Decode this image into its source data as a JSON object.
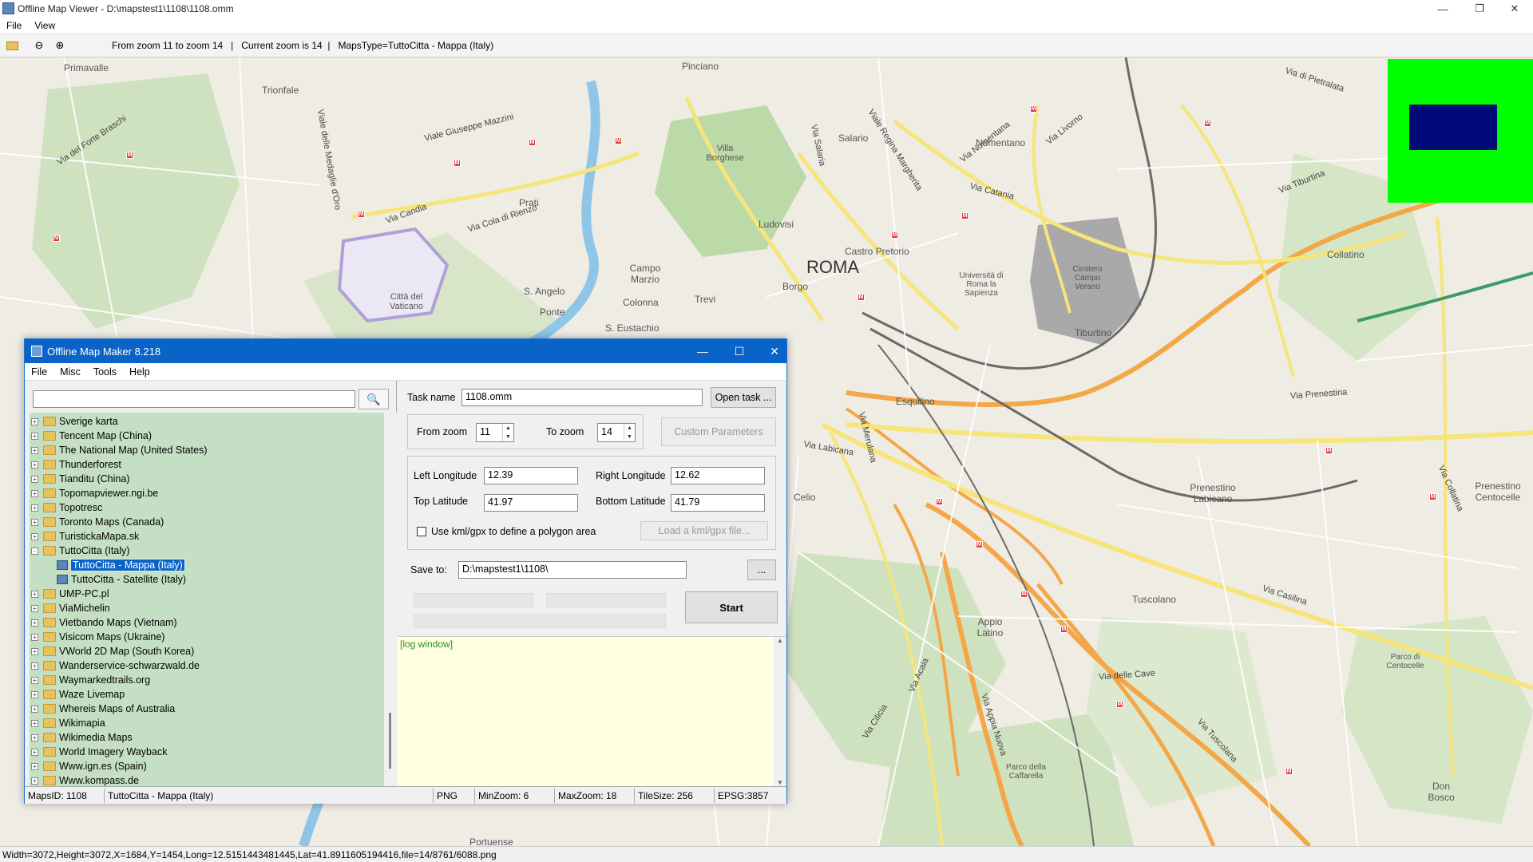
{
  "viewer": {
    "title": "Offline Map Viewer - D:\\mapstest1\\1108\\1108.omm",
    "menu": [
      "File",
      "View"
    ],
    "toolbar_info": "From zoom 11 to zoom 14   |   Current zoom is 14  |   MapsType=TuttoCitta - Mappa (Italy)",
    "status": "Width=3072,Height=3072,X=1684,Y=1454,Long=12.5151443481445,Lat=41.8911605194416,file=14/8761/6088.png"
  },
  "map": {
    "city_label": "ROMA",
    "places": [
      "Primavalle",
      "Trionfale",
      "Prati",
      "Pinciano",
      "Villa Borghese",
      "Salario",
      "Nomentano",
      "Ludovisi",
      "Castro Pretorio",
      "Città del Vaticano",
      "S. Angelo",
      "Campo Marzio",
      "Colonna",
      "Trevi",
      "Ponte",
      "S. Eustachio",
      "Borgo",
      "Università di Roma la Sapienza",
      "Cimitero Campo Verano",
      "Tiburtino",
      "Collatino",
      "Esquilino",
      "Celio",
      "Prenestino Labicano",
      "Tuscolano",
      "Appio Latino",
      "Parco di Centocelle",
      "Parco della Caffarella",
      "Don Bosco",
      "Prenestino Centocelle",
      "Portuense"
    ],
    "roads": [
      "Via Nomentana",
      "Via Tiburtina",
      "Via Prenestina",
      "Via Casilina",
      "Via Appia Nuova",
      "Via Tuscolana",
      "Via delle Cave",
      "Via Labicana",
      "Via Candia",
      "Via Cola di Rienzo",
      "Viale Giuseppe Mazzini",
      "Viale Regina Margherita",
      "Via Salaria",
      "Via Merulana",
      "Via Acaia",
      "Via Cilicia",
      "Via del Forte Braschi",
      "Viale delle Medaglie d'Oro",
      "Via Livorno",
      "Via Catania",
      "Via di Pietralata",
      "Via Collatina"
    ]
  },
  "dialog": {
    "title": "Offline Map Maker 8.218",
    "menu": [
      "File",
      "Misc",
      "Tools",
      "Help"
    ],
    "search_value": "",
    "tree": [
      {
        "label": "Sverige karta",
        "level": 0,
        "exp": "+"
      },
      {
        "label": "Tencent Map (China)",
        "level": 0,
        "exp": "+"
      },
      {
        "label": "The National Map (United States)",
        "level": 0,
        "exp": "+"
      },
      {
        "label": "Thunderforest",
        "level": 0,
        "exp": "+"
      },
      {
        "label": "Tianditu (China)",
        "level": 0,
        "exp": "+"
      },
      {
        "label": "Topomapviewer.ngi.be",
        "level": 0,
        "exp": "+"
      },
      {
        "label": "Topotresc",
        "level": 0,
        "exp": "+"
      },
      {
        "label": "Toronto Maps (Canada)",
        "level": 0,
        "exp": "+"
      },
      {
        "label": "TuristickaMapa.sk",
        "level": 0,
        "exp": "+"
      },
      {
        "label": "TuttoCitta (Italy)",
        "level": 0,
        "exp": "-"
      },
      {
        "label": "TuttoCitta - Mappa (Italy)",
        "level": 1,
        "selected": true
      },
      {
        "label": "TuttoCitta - Satellite (Italy)",
        "level": 1
      },
      {
        "label": "UMP-PC.pl",
        "level": 0,
        "exp": "+"
      },
      {
        "label": "ViaMichelin",
        "level": 0,
        "exp": "+"
      },
      {
        "label": "Vietbando Maps (Vietnam)",
        "level": 0,
        "exp": "+"
      },
      {
        "label": "Visicom Maps (Ukraine)",
        "level": 0,
        "exp": "+"
      },
      {
        "label": "VWorld 2D Map (South Korea)",
        "level": 0,
        "exp": "+"
      },
      {
        "label": "Wanderservice-schwarzwald.de",
        "level": 0,
        "exp": "+"
      },
      {
        "label": "Waymarkedtrails.org",
        "level": 0,
        "exp": "+"
      },
      {
        "label": "Waze Livemap",
        "level": 0,
        "exp": "+"
      },
      {
        "label": "Whereis Maps of Australia",
        "level": 0,
        "exp": "+"
      },
      {
        "label": "Wikimapia",
        "level": 0,
        "exp": "+"
      },
      {
        "label": "Wikimedia Maps",
        "level": 0,
        "exp": "+"
      },
      {
        "label": "World Imagery Wayback",
        "level": 0,
        "exp": "+"
      },
      {
        "label": "Www.ign.es (Spain)",
        "level": 0,
        "exp": "+"
      },
      {
        "label": "Www.kompass.de",
        "level": 0,
        "exp": "+"
      }
    ],
    "task_name_label": "Task name",
    "task_name_value": "1108.omm",
    "open_task": "Open task ...",
    "from_zoom_label": "From zoom",
    "from_zoom_value": "11",
    "to_zoom_label": "To zoom",
    "to_zoom_value": "14",
    "custom_params": "Custom Parameters",
    "left_lon_label": "Left Longitude",
    "left_lon_value": "12.39",
    "right_lon_label": "Right Longitude",
    "right_lon_value": "12.62",
    "top_lat_label": "Top Latitude",
    "top_lat_value": "41.97",
    "bottom_lat_label": "Bottom Latitude",
    "bottom_lat_value": "41.79",
    "kml_label": "Use kml/gpx to define a polygon area",
    "load_kml": "Load a kml/gpx file...",
    "save_to_label": "Save to:",
    "save_to_value": "D:\\mapstest1\\1108\\",
    "browse": "...",
    "start": "Start",
    "log": "[log window]",
    "status": [
      "MapsID: 1108",
      "TuttoCitta - Mappa (Italy)",
      "PNG",
      "MinZoom: 6",
      "MaxZoom: 18",
      "TileSize: 256",
      "EPSG:3857"
    ]
  },
  "colors": {
    "overview_bg": "#00ff00",
    "overview_viewport": "#000a78",
    "dialog_title": "#0a64c8",
    "tree_bg": "#c4dfc4",
    "log_bg": "#ffffe1"
  }
}
